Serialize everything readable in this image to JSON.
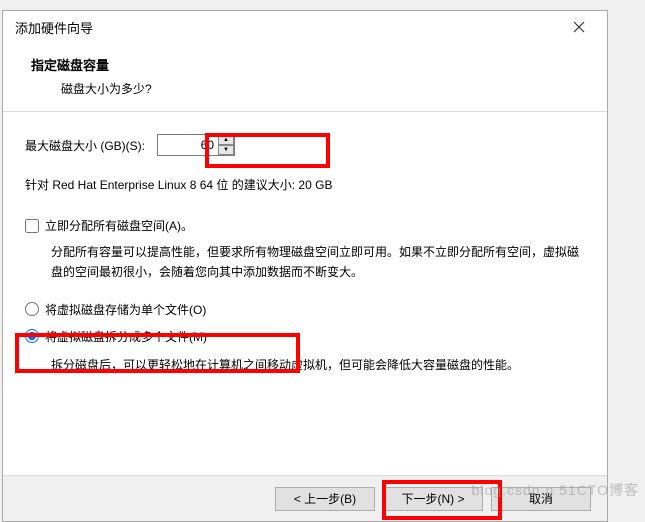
{
  "dialog": {
    "title": "添加硬件向导"
  },
  "header": {
    "title": "指定磁盘容量",
    "subtitle": "磁盘大小为多少?"
  },
  "size": {
    "label": "最大磁盘大小 (GB)(S):",
    "value": "60"
  },
  "recommendation": "针对 Red Hat Enterprise Linux 8 64 位 的建议大小: 20 GB",
  "allocate": {
    "label": "立即分配所有磁盘空间(A)。",
    "desc": "分配所有容量可以提高性能，但要求所有物理磁盘空间立即可用。如果不立即分配所有空间，虚拟磁盘的空间最初很小，会随着您向其中添加数据而不断变大。"
  },
  "radio": {
    "single": "将虚拟磁盘存储为单个文件(O)",
    "multi": "将虚拟磁盘拆分成多个文件(M)",
    "multi_desc": "拆分磁盘后，可以更轻松地在计算机之间移动虚拟机，但可能会降低大容量磁盘的性能。"
  },
  "buttons": {
    "back": "< 上一步(B)",
    "next": "下一步(N) >",
    "cancel": "取消"
  },
  "watermark": "blog.csdn.n   51CTO博客"
}
